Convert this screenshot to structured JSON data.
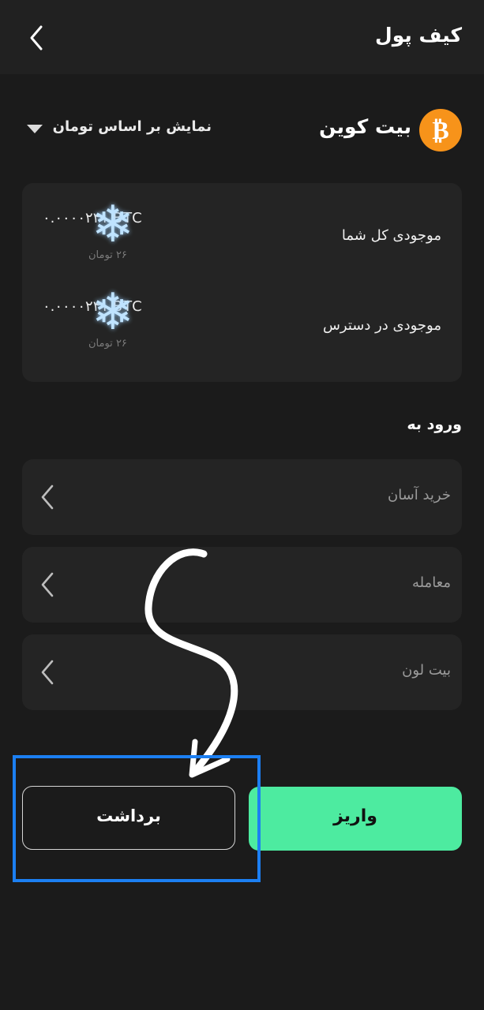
{
  "header": {
    "title": "کیف پول",
    "back_icon": "chevron-left-icon"
  },
  "coin": {
    "name": "بیت کوین",
    "icon": "bitcoin-icon",
    "symbol": "₿",
    "icon_color": "#f7931a"
  },
  "currency_select": {
    "label": "نمایش بر اساس تومان",
    "icon": "triangle-down-icon"
  },
  "balances": [
    {
      "label": "موجودی کل شما",
      "value": "٠.٠٠٠٠٢۴١ BTC",
      "sub": "۲۶ تومان"
    },
    {
      "label": "موجودی در دسترس",
      "value": "٠.٠٠٠٠٢۴١ BTC",
      "sub": "۲۶ تومان"
    }
  ],
  "section_title": "ورود به",
  "nav_items": [
    {
      "label": "خرید آسان"
    },
    {
      "label": "معامله"
    },
    {
      "label": "بیت لون"
    }
  ],
  "actions": {
    "deposit": "واریز",
    "withdraw": "برداشت"
  },
  "colors": {
    "background": "#1b1b1b",
    "card": "#242424",
    "accent_green": "#4deba0",
    "highlight_blue": "#1c7ff2"
  }
}
